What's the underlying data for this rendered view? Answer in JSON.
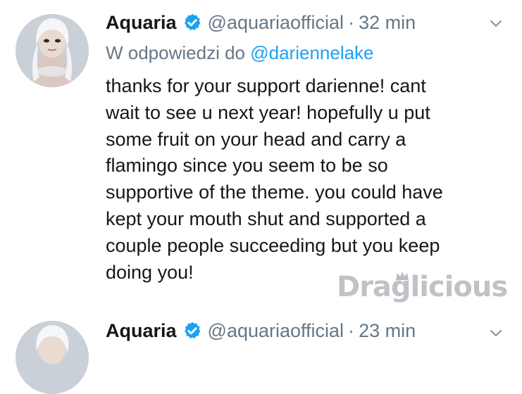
{
  "tweets": [
    {
      "author": {
        "name": "Aquaria",
        "handle": "@aquariaofficial",
        "verified": true,
        "avatar": "avatar-photo"
      },
      "separator": "·",
      "time": "32 min",
      "reply": {
        "prefix": "W odpowiedzi do",
        "mention": "@darienne​lake"
      },
      "text": "thanks for your support darienne! cant\nwait to see u next year! hopefully u put\nsome fruit on your head and carry a\nflamingo since you seem to be so\nsupportive of the theme. you could have\nkept your mouth shut and supported a\ncouple people succeeding but you keep\ndoing you!",
      "menu_icon": "chevron-down-icon"
    },
    {
      "author": {
        "name": "Aquaria",
        "handle": "@aquariaofficial",
        "verified": true,
        "avatar": "avatar-photo"
      },
      "separator": "·",
      "time": "23 min",
      "menu_icon": "chevron-down-icon"
    }
  ],
  "watermark": {
    "logo": "Draglicious",
    "icon": "crown-icon"
  },
  "colors": {
    "text": "#14171a",
    "secondary": "#657786",
    "link": "#1da1f2",
    "verified_badge": "#1da1f2",
    "watermark": "#b9bcc0"
  }
}
